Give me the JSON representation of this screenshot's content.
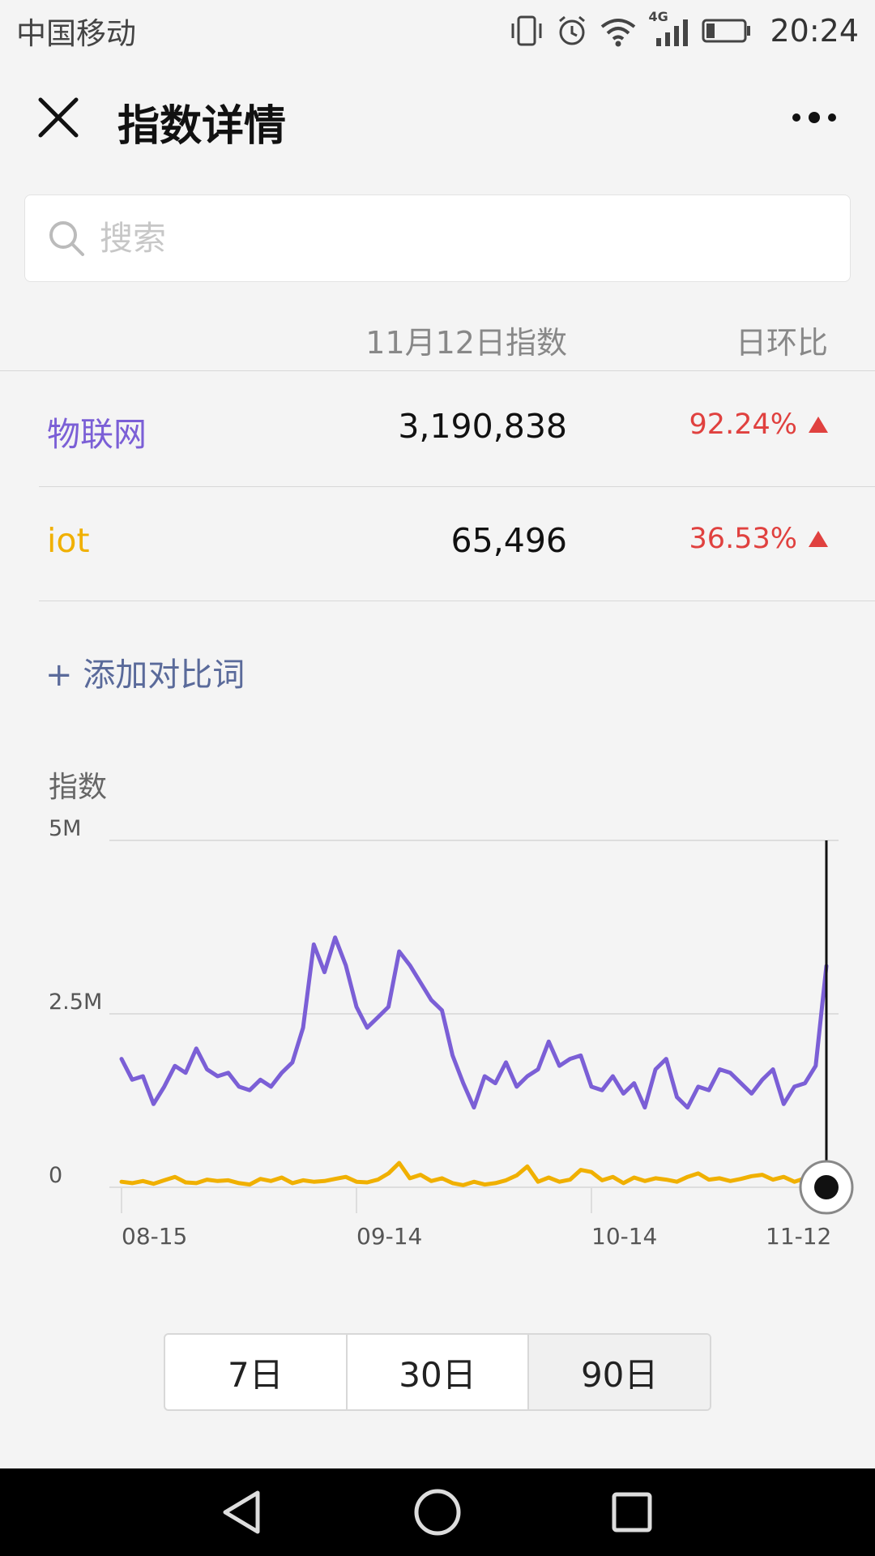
{
  "status": {
    "carrier": "中国移动",
    "network": "4G",
    "time": "20:24"
  },
  "header": {
    "title": "指数详情"
  },
  "search": {
    "placeholder": "搜索"
  },
  "table": {
    "col_date": "11月12日指数",
    "col_ratio": "日环比",
    "rows": [
      {
        "term": "物联网",
        "value": "3,190,838",
        "ratio": "92.24%",
        "color": "#7b5fd6"
      },
      {
        "term": "iot",
        "value": "65,496",
        "ratio": "36.53%",
        "color": "#f0b000"
      }
    ]
  },
  "add_compare_label": "+ 添加对比词",
  "ranges": [
    "7日",
    "30日",
    "90日"
  ],
  "active_range": "90日",
  "chart_data": {
    "type": "line",
    "ylabel": "指数",
    "ytick_labels": [
      "5M",
      "2.5M",
      "0"
    ],
    "ylim": [
      0,
      5000000
    ],
    "xtick_labels": [
      "08-15",
      "09-14",
      "10-14",
      "11-12"
    ],
    "series": [
      {
        "name": "物联网",
        "color": "#7b5fd6",
        "values": [
          1850000,
          1550000,
          1600000,
          1200000,
          1450000,
          1750000,
          1650000,
          2000000,
          1700000,
          1600000,
          1650000,
          1450000,
          1400000,
          1550000,
          1450000,
          1650000,
          1800000,
          2300000,
          3500000,
          3100000,
          3600000,
          3200000,
          2600000,
          2300000,
          2450000,
          2600000,
          3400000,
          3200000,
          2950000,
          2700000,
          2550000,
          1900000,
          1500000,
          1150000,
          1600000,
          1500000,
          1800000,
          1450000,
          1600000,
          1700000,
          2100000,
          1750000,
          1850000,
          1900000,
          1450000,
          1400000,
          1600000,
          1350000,
          1500000,
          1150000,
          1700000,
          1850000,
          1300000,
          1150000,
          1450000,
          1400000,
          1700000,
          1650000,
          1500000,
          1350000,
          1550000,
          1700000,
          1200000,
          1450000,
          1500000,
          1750000,
          3190838
        ]
      },
      {
        "name": "iot",
        "color": "#f0b000",
        "values": [
          80000,
          60000,
          90000,
          50000,
          100000,
          150000,
          70000,
          60000,
          110000,
          90000,
          100000,
          60000,
          40000,
          120000,
          90000,
          140000,
          60000,
          100000,
          80000,
          90000,
          120000,
          150000,
          80000,
          70000,
          110000,
          200000,
          350000,
          130000,
          180000,
          90000,
          130000,
          60000,
          30000,
          80000,
          40000,
          60000,
          100000,
          170000,
          300000,
          80000,
          140000,
          80000,
          110000,
          250000,
          220000,
          100000,
          150000,
          60000,
          140000,
          90000,
          130000,
          110000,
          80000,
          150000,
          200000,
          110000,
          130000,
          90000,
          120000,
          160000,
          180000,
          110000,
          150000,
          80000,
          130000,
          100000,
          65496
        ]
      }
    ]
  }
}
